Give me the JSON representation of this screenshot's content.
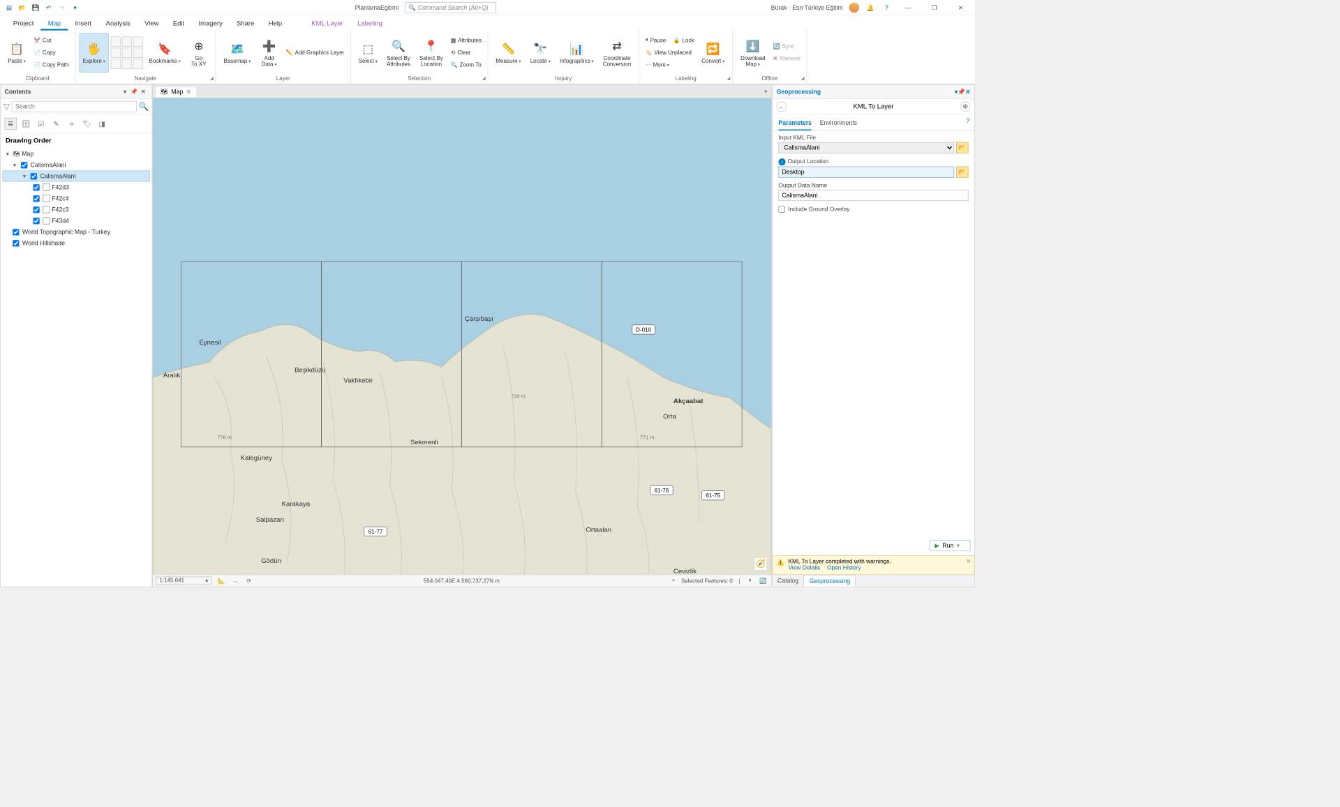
{
  "app": {
    "project_title": "PlanlamaEgitimi",
    "search_placeholder": "Command Search (Alt+Q)",
    "user_label": "Burak · Esri Türkiye Eğitim"
  },
  "tabs": {
    "project": "Project",
    "map": "Map",
    "insert": "Insert",
    "analysis": "Analysis",
    "view": "View",
    "edit": "Edit",
    "imagery": "Imagery",
    "share": "Share",
    "help": "Help",
    "kml_layer": "KML Layer",
    "labeling": "Labeling"
  },
  "ribbon": {
    "clipboard": {
      "label": "Clipboard",
      "paste": "Paste",
      "cut": "Cut",
      "copy": "Copy",
      "copy_path": "Copy Path"
    },
    "navigate": {
      "label": "Navigate",
      "explore": "Explore",
      "bookmarks": "Bookmarks",
      "goto": "Go\nTo XY"
    },
    "layer": {
      "label": "Layer",
      "basemap": "Basemap",
      "add_data": "Add\nData",
      "add_graphics": "Add Graphics Layer"
    },
    "selection": {
      "label": "Selection",
      "select": "Select",
      "by_attr": "Select By\nAttributes",
      "by_loc": "Select By\nLocation",
      "attributes": "Attributes",
      "clear": "Clear",
      "zoom_to": "Zoom To"
    },
    "inquiry": {
      "label": "Inquiry",
      "measure": "Measure",
      "locate": "Locate",
      "infog": "Infographics",
      "coord": "Coordinate\nConversion"
    },
    "labeling": {
      "label": "Labeling",
      "pause": "Pause",
      "lock": "Lock",
      "view_unplaced": "View Unplaced",
      "more": "More",
      "convert": "Convert"
    },
    "offline": {
      "label": "Offline",
      "download": "Download\nMap",
      "sync": "Sync",
      "remove": "Remove"
    }
  },
  "contents": {
    "title": "Contents",
    "search_placeholder": "Search",
    "drawing_order": "Drawing Order",
    "map": "Map",
    "group": "CalismaAlani",
    "layer": "CalismaAlani",
    "sub": [
      "F42d3",
      "F42c4",
      "F42c3",
      "F43d4"
    ],
    "base1": "World Topographic Map - Turkey",
    "base2": "World Hillshade"
  },
  "view_tab": {
    "name": "Map"
  },
  "map_labels": {
    "aralik": "Aralık",
    "eynesil": "Eynesil",
    "besikduzu": "Beşikdüzü",
    "vakfikebir": "Vakfıkebir",
    "carsibasi": "Çarşıbaşı",
    "akcaabat": "Akçaabat",
    "orta": "Orta",
    "sekmenli": "Sekmenli",
    "kaleguney": "Kalegüney",
    "karakaya": "Karakaya",
    "salpazari": "Salpazarı",
    "godun": "Gödün",
    "ortaalan": "Ortaalan",
    "cevizlik": "Cevizlik",
    "r771": "771 m",
    "r776": "776 m",
    "r720": "720 m",
    "shield_d010": "D-010",
    "shield_6177": "61-77",
    "shield_6176": "61-76",
    "shield_6175": "61-75"
  },
  "status": {
    "scale": "1:145.641",
    "coord": "554.047,40E 4.560.737,27N m",
    "sel": "Selected Features: 0"
  },
  "gp": {
    "title": "Geoprocessing",
    "tool": "KML To Layer",
    "tab_params": "Parameters",
    "tab_env": "Environments",
    "f_input": "Input KML File",
    "v_input": "CalismaAlani",
    "f_output_loc": "Output Location",
    "v_output_loc": "Desktop",
    "f_output_name": "Output Data Name",
    "v_output_name": "CalismaAlani",
    "f_overlay": "Include Ground Overlay",
    "run": "Run",
    "msg": "KML To Layer completed with warnings.",
    "view_details": "View Details",
    "open_history": "Open History",
    "tab_catalog": "Catalog",
    "tab_gp": "Geoprocessing"
  }
}
